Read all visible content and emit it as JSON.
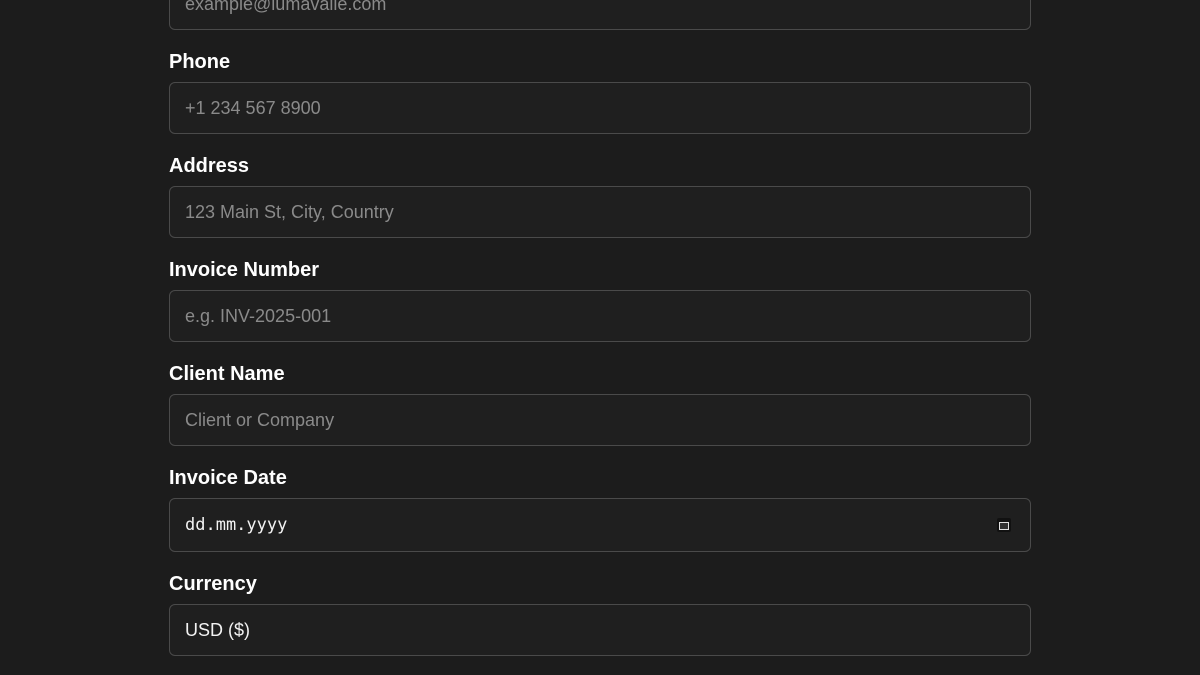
{
  "form": {
    "fields": [
      {
        "label": "",
        "placeholder": "example@lumavalle.com",
        "value": ""
      },
      {
        "label": "Phone",
        "placeholder": "+1 234 567 8900",
        "value": ""
      },
      {
        "label": "Address",
        "placeholder": "123 Main St, City, Country",
        "value": ""
      },
      {
        "label": "Invoice Number",
        "placeholder": "e.g. INV-2025-001",
        "value": ""
      },
      {
        "label": "Client Name",
        "placeholder": "Client or Company",
        "value": ""
      },
      {
        "label": "Invoice Date",
        "placeholder": "",
        "value": "dd.mm.yyyy",
        "icon": "calendar-icon"
      },
      {
        "label": "Currency",
        "placeholder": "",
        "value": "USD ($)"
      }
    ]
  }
}
